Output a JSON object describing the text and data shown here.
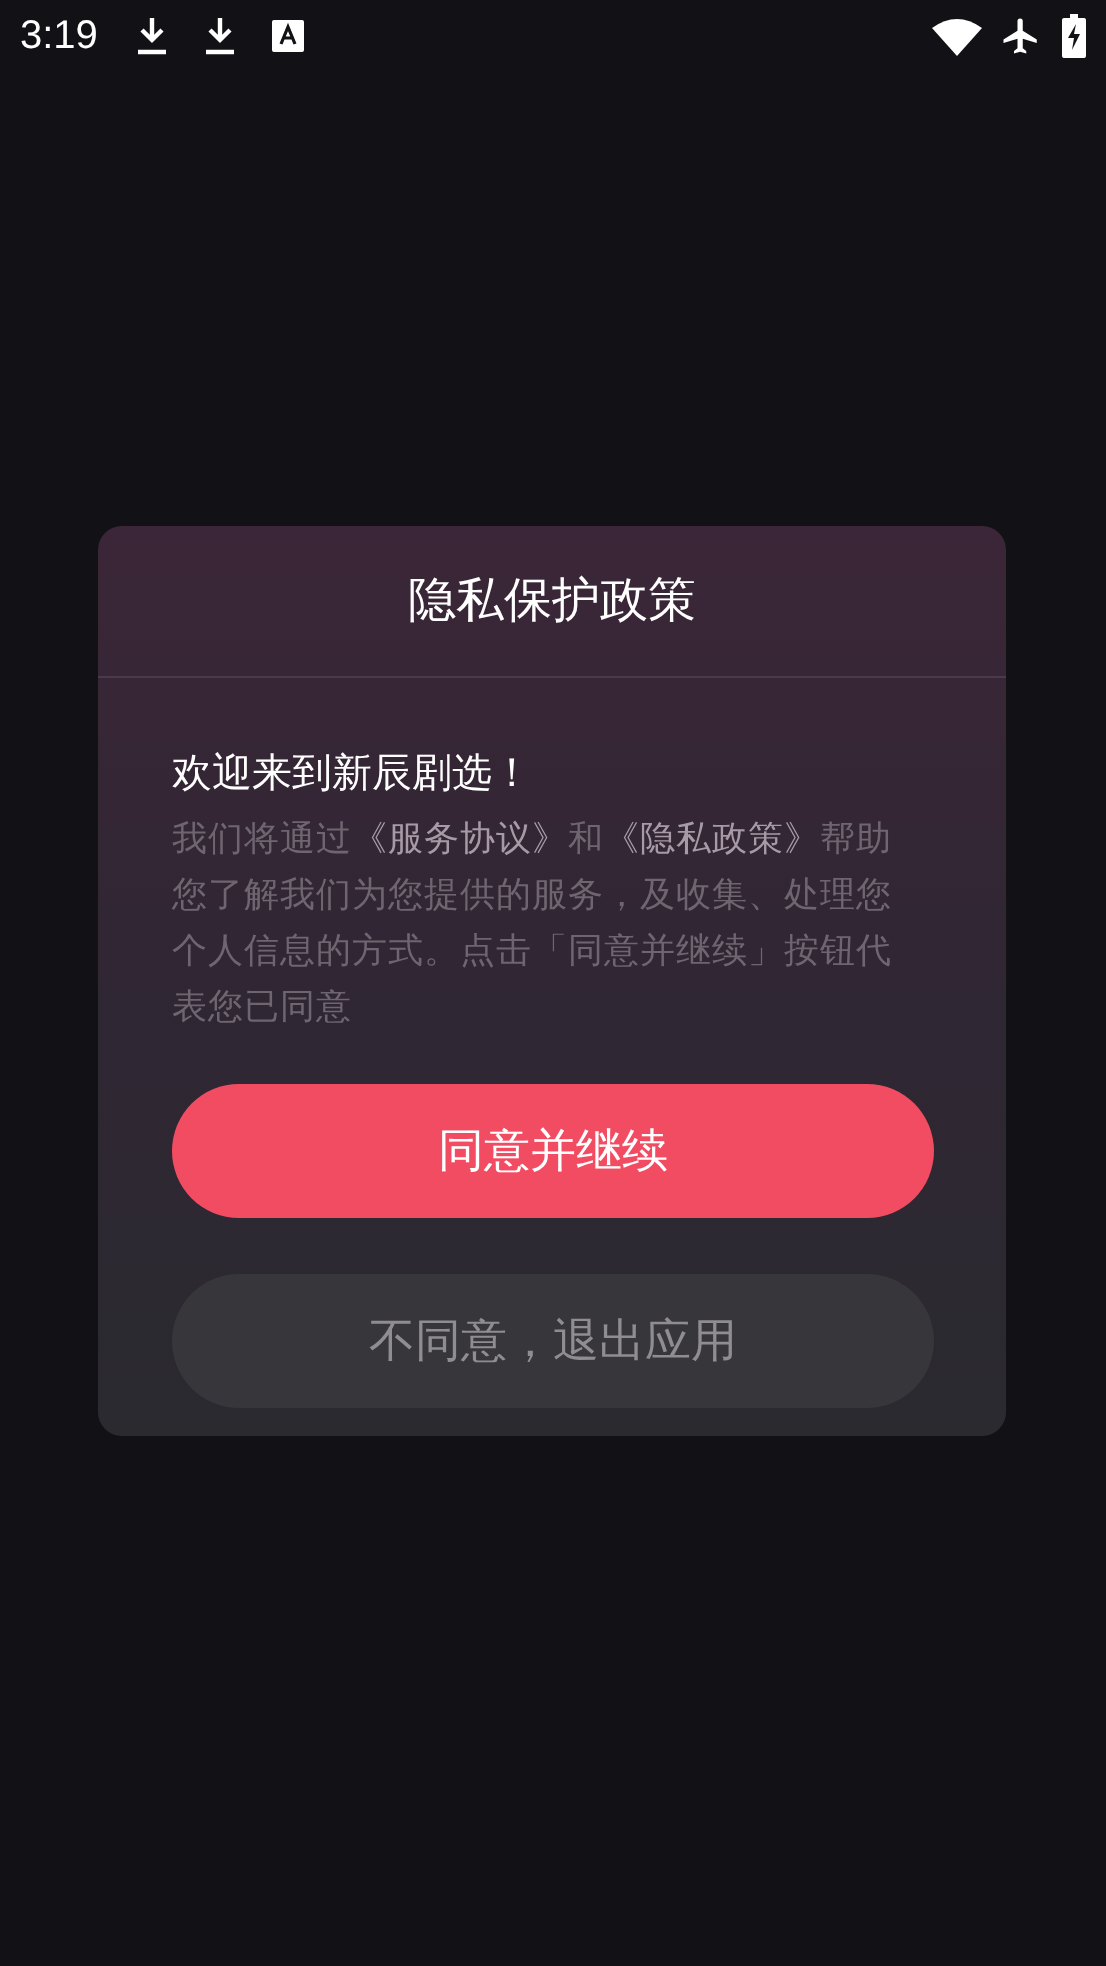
{
  "status_bar": {
    "time": "3:19"
  },
  "dialog": {
    "title": "隐私保护政策",
    "heading": "欢迎来到新辰剧选！",
    "body": [
      {
        "kind": "text",
        "text": "我们将通过"
      },
      {
        "kind": "link",
        "text": "《服务协议》"
      },
      {
        "kind": "text",
        "text": "和"
      },
      {
        "kind": "link",
        "text": "《隐私政策》"
      },
      {
        "kind": "text",
        "text": "帮助您了解我们为您提供的服务，及收集、处理您个人信息的方式。点击「同意并继续」按钮代表您已同意"
      }
    ],
    "buttons": [
      {
        "kind": "primary",
        "label": "同意并继续"
      },
      {
        "kind": "secondary",
        "label": "不同意，退出应用"
      }
    ]
  }
}
